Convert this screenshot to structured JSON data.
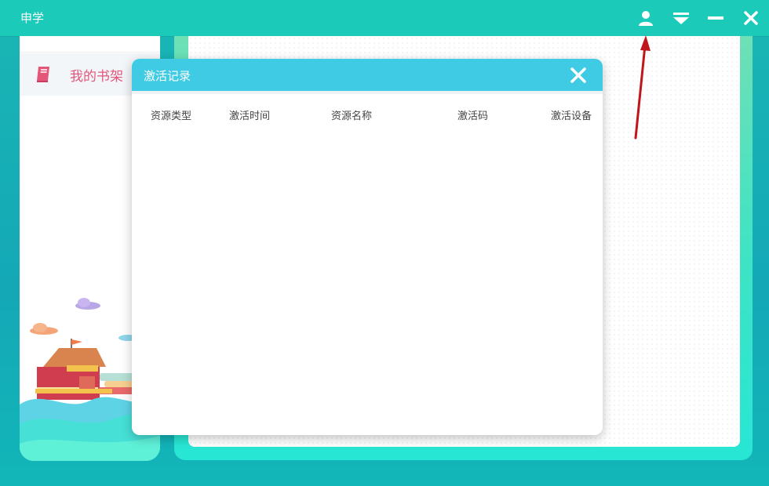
{
  "app": {
    "title": "申学"
  },
  "titlebar": {
    "icons": [
      "user-icon",
      "dropdown-menu-icon",
      "minimize-icon",
      "close-icon"
    ]
  },
  "sidebar": {
    "items": [
      {
        "label": "我的书架",
        "icon": "book-icon"
      }
    ]
  },
  "dialog": {
    "title": "激活记录",
    "columns": [
      "资源类型",
      "激活时间",
      "资源名称",
      "激活码",
      "激活设备"
    ],
    "rows": []
  },
  "colors": {
    "titlebar": "#1ccaba",
    "dialog_header": "#3fcbe3",
    "accent_pink": "#e2567a",
    "annotation_arrow": "#c0161b"
  }
}
